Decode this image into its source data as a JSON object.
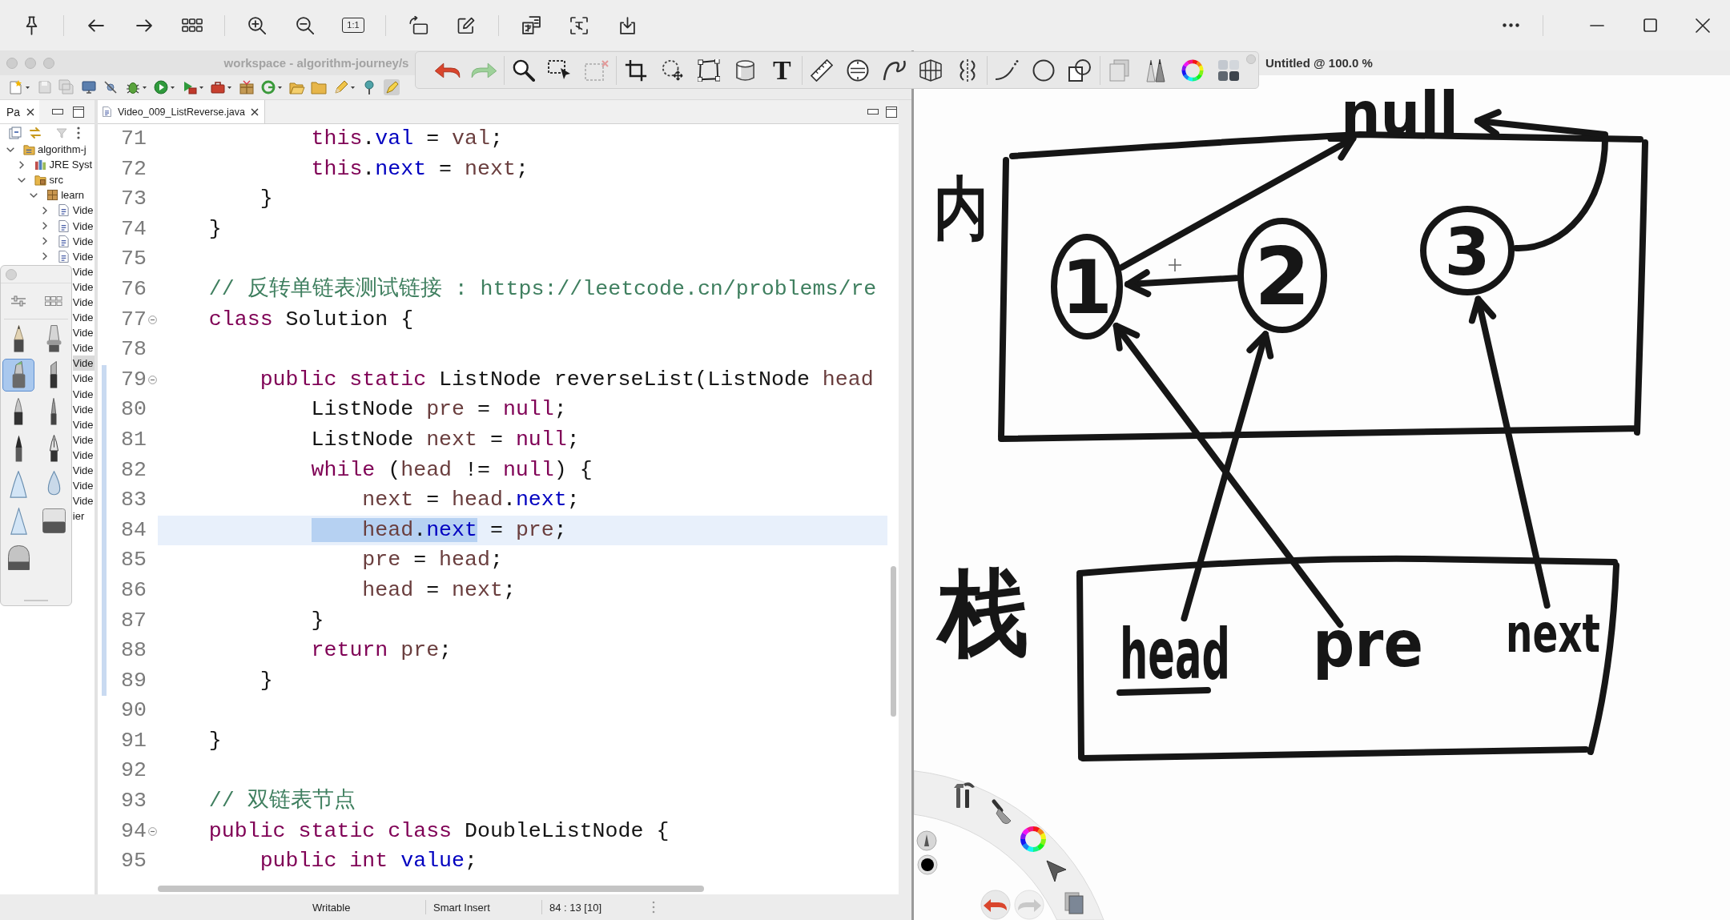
{
  "viewer": {
    "actual_size": "1:1"
  },
  "eclipse": {
    "title": "workspace - algorithm-journey/s",
    "explorer": {
      "tab": "Pa",
      "tree": [
        {
          "label": "algorithm-j",
          "kind": "project",
          "expanded": true,
          "selected": false,
          "children": [
            {
              "label": "JRE Syst",
              "kind": "library",
              "expanded": false,
              "selected": false
            },
            {
              "label": "src",
              "kind": "folder",
              "expanded": true,
              "selected": false,
              "children": [
                {
                  "label": "learn",
                  "kind": "package",
                  "expanded": true,
                  "selected": false,
                  "children": [
                    {
                      "label": "Vide",
                      "kind": "java",
                      "expanded": false,
                      "selected": false
                    },
                    {
                      "label": "Vide",
                      "kind": "java",
                      "expanded": false,
                      "selected": false
                    },
                    {
                      "label": "Vide",
                      "kind": "java",
                      "expanded": false,
                      "selected": false
                    },
                    {
                      "label": "Vide",
                      "kind": "java",
                      "expanded": false,
                      "selected": false
                    },
                    {
                      "label": "Vide",
                      "selected": false
                    },
                    {
                      "label": "Vide",
                      "selected": false
                    },
                    {
                      "label": "Vide",
                      "selected": false
                    },
                    {
                      "label": "Vide",
                      "selected": false
                    },
                    {
                      "label": "Vide",
                      "selected": false
                    },
                    {
                      "label": "Vide",
                      "selected": false
                    },
                    {
                      "label": "Vide",
                      "selected": true
                    },
                    {
                      "label": "Vide",
                      "selected": false
                    },
                    {
                      "label": "Vide",
                      "selected": false
                    },
                    {
                      "label": "Vide",
                      "selected": false
                    },
                    {
                      "label": "Vide",
                      "selected": false
                    },
                    {
                      "label": "Vide",
                      "selected": false
                    },
                    {
                      "label": "Vide",
                      "selected": false
                    },
                    {
                      "label": "Vide",
                      "selected": false
                    },
                    {
                      "label": "Vide",
                      "selected": false
                    },
                    {
                      "label": "Vide",
                      "selected": false
                    },
                    {
                      "label": "ier",
                      "selected": false
                    }
                  ]
                }
              ]
            }
          ]
        }
      ]
    },
    "editor": {
      "tab": "Video_009_ListReverse.java",
      "lines": [
        {
          "children": [
            {
              "children": [
                {
                  "number": "71",
                  "current": false,
                  "in_scope": false,
                  "foldable": false,
                  "tokens": [
                    {
                      "text": "this",
                      "kind": "keyword"
                    },
                    {
                      "text": ".",
                      "kind": "plain"
                    },
                    {
                      "text": "val",
                      "kind": "field"
                    },
                    {
                      "text": " = ",
                      "kind": "plain"
                    },
                    {
                      "text": "val",
                      "kind": "variable"
                    },
                    {
                      "text": ";",
                      "kind": "plain"
                    }
                  ]
                },
                {
                  "number": "72",
                  "current": false,
                  "in_scope": false,
                  "foldable": false,
                  "tokens": [
                    {
                      "text": "this",
                      "kind": "keyword"
                    },
                    {
                      "text": ".",
                      "kind": "plain"
                    },
                    {
                      "text": "next",
                      "kind": "field"
                    },
                    {
                      "text": " = ",
                      "kind": "plain"
                    },
                    {
                      "text": "next",
                      "kind": "variable"
                    },
                    {
                      "text": ";",
                      "kind": "plain"
                    }
                  ]
                }
              ]
            },
            {
              "number": "73",
              "current": false,
              "in_scope": false,
              "foldable": false,
              "tokens": [
                {
                  "text": "}",
                  "kind": "plain"
                }
              ]
            }
          ]
        },
        {
          "number": "74",
          "current": false,
          "in_scope": false,
          "foldable": false,
          "tokens": [
            {
              "text": "}",
              "kind": "plain"
            }
          ]
        },
        {
          "number": "75",
          "current": false,
          "in_scope": false,
          "foldable": false
        },
        {
          "number": "76",
          "current": false,
          "in_scope": false,
          "foldable": false,
          "tokens": [
            {
              "text": "// 反转单链表测试链接 : https://leetcode.cn/problems/re",
              "kind": "comment"
            }
          ]
        },
        {
          "number": "77",
          "current": false,
          "in_scope": false,
          "foldable": true,
          "tokens": [
            {
              "text": "class",
              "kind": "keyword"
            },
            {
              "text": " Solution {",
              "kind": "plain"
            }
          ],
          "children": [
            {
              "number": "78",
              "current": false,
              "in_scope": false,
              "foldable": false
            },
            {
              "number": "79",
              "current": false,
              "in_scope": true,
              "foldable": true,
              "tokens": [
                {
                  "text": "public static",
                  "kind": "keyword"
                },
                {
                  "text": " ListNode reverseList(ListNode ",
                  "kind": "plain"
                },
                {
                  "text": "head",
                  "kind": "variable"
                }
              ],
              "children": [
                {
                  "number": "80",
                  "current": false,
                  "in_scope": true,
                  "foldable": false,
                  "tokens": [
                    {
                      "text": "ListNode ",
                      "kind": "plain"
                    },
                    {
                      "text": "pre",
                      "kind": "variable"
                    },
                    {
                      "text": " = ",
                      "kind": "plain"
                    },
                    {
                      "text": "null",
                      "kind": "keyword"
                    },
                    {
                      "text": ";",
                      "kind": "plain"
                    }
                  ]
                },
                {
                  "number": "81",
                  "current": false,
                  "in_scope": true,
                  "foldable": false,
                  "tokens": [
                    {
                      "text": "ListNode ",
                      "kind": "plain"
                    },
                    {
                      "text": "next",
                      "kind": "variable"
                    },
                    {
                      "text": " = ",
                      "kind": "plain"
                    },
                    {
                      "text": "null",
                      "kind": "keyword"
                    },
                    {
                      "text": ";",
                      "kind": "plain"
                    }
                  ]
                },
                {
                  "number": "82",
                  "current": false,
                  "in_scope": true,
                  "foldable": false,
                  "tokens": [
                    {
                      "text": "while",
                      "kind": "keyword"
                    },
                    {
                      "text": " (",
                      "kind": "plain"
                    },
                    {
                      "text": "head",
                      "kind": "variable"
                    },
                    {
                      "text": " != ",
                      "kind": "plain"
                    },
                    {
                      "text": "null",
                      "kind": "keyword"
                    },
                    {
                      "text": ") {",
                      "kind": "plain"
                    }
                  ],
                  "children": [
                    {
                      "number": "83",
                      "current": false,
                      "in_scope": true,
                      "foldable": false,
                      "tokens": [
                        {
                          "text": "next",
                          "kind": "variable"
                        },
                        {
                          "text": " = ",
                          "kind": "plain"
                        },
                        {
                          "text": "head",
                          "kind": "variable"
                        },
                        {
                          "text": ".",
                          "kind": "plain"
                        },
                        {
                          "text": "next",
                          "kind": "field"
                        },
                        {
                          "text": ";",
                          "kind": "plain"
                        }
                      ]
                    },
                    {
                      "number": "84",
                      "current": true,
                      "in_scope": true,
                      "foldable": false,
                      "tokens": [
                        {
                          "kind": "selection",
                          "tokens": [
                            {
                              "text": "    head",
                              "kind": "variable"
                            },
                            {
                              "text": ".",
                              "kind": "plain"
                            },
                            {
                              "text": "next",
                              "kind": "field"
                            }
                          ]
                        },
                        {
                          "text": " = ",
                          "kind": "plain"
                        },
                        {
                          "text": "pre",
                          "kind": "variable"
                        },
                        {
                          "text": ";",
                          "kind": "plain"
                        }
                      ]
                    },
                    {
                      "number": "85",
                      "current": false,
                      "in_scope": true,
                      "foldable": false,
                      "tokens": [
                        {
                          "text": "pre",
                          "kind": "variable"
                        },
                        {
                          "text": " = ",
                          "kind": "plain"
                        },
                        {
                          "text": "head",
                          "kind": "variable"
                        },
                        {
                          "text": ";",
                          "kind": "plain"
                        }
                      ]
                    },
                    {
                      "number": "86",
                      "current": false,
                      "in_scope": true,
                      "foldable": false,
                      "tokens": [
                        {
                          "text": "head",
                          "kind": "variable"
                        },
                        {
                          "text": " = ",
                          "kind": "plain"
                        },
                        {
                          "text": "next",
                          "kind": "variable"
                        },
                        {
                          "text": ";",
                          "kind": "plain"
                        }
                      ]
                    }
                  ]
                },
                {
                  "number": "87",
                  "current": false,
                  "in_scope": true,
                  "foldable": false,
                  "tokens": [
                    {
                      "text": "}",
                      "kind": "plain"
                    }
                  ]
                },
                {
                  "number": "88",
                  "current": false,
                  "in_scope": true,
                  "foldable": false,
                  "tokens": [
                    {
                      "text": "return",
                      "kind": "keyword"
                    },
                    {
                      "text": " pre",
                      "kind": "variable"
                    },
                    {
                      "text": ";",
                      "kind": "plain"
                    }
                  ]
                }
              ]
            },
            {
              "number": "89",
              "current": false,
              "in_scope": true,
              "foldable": false,
              "tokens": [
                {
                  "text": "}",
                  "kind": "plain"
                }
              ]
            },
            {
              "number": "90",
              "current": false,
              "in_scope": false,
              "foldable": false
            }
          ]
        },
        {
          "number": "91",
          "current": false,
          "in_scope": false,
          "foldable": false,
          "tokens": [
            {
              "text": "}",
              "kind": "plain"
            }
          ]
        },
        {
          "number": "92",
          "current": false,
          "in_scope": false,
          "foldable": false
        },
        {
          "number": "93",
          "current": false,
          "in_scope": false,
          "foldable": false,
          "tokens": [
            {
              "text": "// 双链表节点",
              "kind": "comment"
            }
          ]
        },
        {
          "number": "94",
          "current": false,
          "in_scope": false,
          "foldable": true,
          "tokens": [
            {
              "text": "public static class",
              "kind": "keyword"
            },
            {
              "text": " DoubleListNode {",
              "kind": "plain"
            }
          ],
          "children": [
            {
              "number": "95",
              "current": false,
              "in_scope": false,
              "foldable": false,
              "tokens": [
                {
                  "text": "public int",
                  "kind": "keyword"
                },
                {
                  "text": " value",
                  "kind": "field"
                },
                {
                  "text": ";",
                  "kind": "plain"
                }
              ]
            }
          ]
        }
      ]
    },
    "status_bar": [
      "Writable",
      "Smart Insert",
      "84 : 13 [10]"
    ]
  },
  "sketchbook": {
    "title": "Untitled @ 100.0 %",
    "toolbar": {
      "text_tool": "T"
    },
    "brushes": [
      {
        "kind": "pencil",
        "selected": false
      },
      {
        "kind": "airbrush",
        "selected": false
      },
      {
        "kind": "marker",
        "selected": true
      },
      {
        "kind": "chisel",
        "selected": false
      },
      {
        "kind": "pen",
        "selected": false
      },
      {
        "kind": "brush",
        "selected": false
      },
      {
        "kind": "ballpoint",
        "selected": false
      },
      {
        "kind": "nib",
        "selected": false
      },
      {
        "kind": "cone",
        "selected": false
      },
      {
        "kind": "drop",
        "selected": false
      },
      {
        "kind": "triangle",
        "selected": false
      },
      {
        "kind": "eraser",
        "selected": false
      },
      {
        "kind": "dome",
        "selected": false
      }
    ],
    "diagram": {
      "regions": [
        {
          "label": "内"
        },
        {
          "label": "栈"
        }
      ],
      "null_label": "null",
      "nodes": [
        {
          "label": "1"
        },
        {
          "label": "2"
        },
        {
          "label": "3"
        }
      ],
      "pointers": [
        {
          "label": "head",
          "underlined": true
        },
        {
          "label": "pre",
          "underlined": false
        },
        {
          "label": "next",
          "underlined": false
        }
      ]
    }
  }
}
